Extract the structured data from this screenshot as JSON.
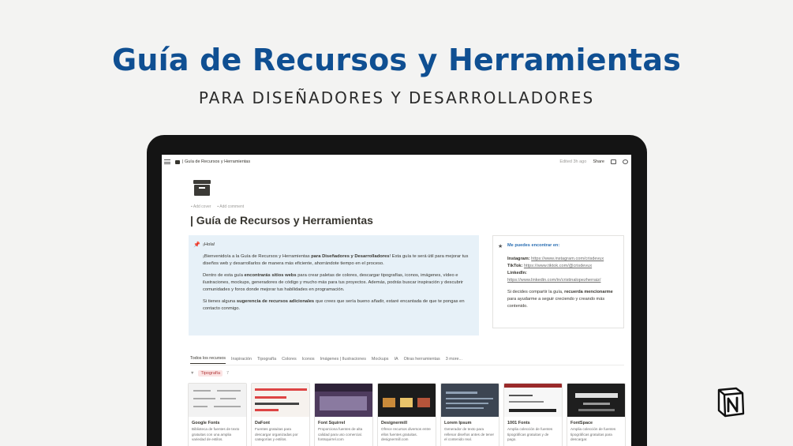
{
  "hero": {
    "title": "Guía de Recursos y Herramientas",
    "subtitle": "PARA DISEÑADORES Y DESARROLLADORES"
  },
  "topbar": {
    "breadcrumb": "| Guía de Recursos y Herramientas",
    "edited": "Edited 3h ago",
    "share": "Share"
  },
  "page": {
    "add_cover": "Add cover",
    "add_comment": "Add comment",
    "title": "| Guía de Recursos y Herramientas"
  },
  "callout": {
    "greeting": "¡Hola!",
    "p1_a": "¡Bienvenido/a a la Guía de Recursos y Herramientas ",
    "p1_b": "para Diseñadores y Desarrolladores",
    "p1_c": "! Esta guía te será útil para mejorar tus diseños web y desarrollarlos de manera más eficiente, ahorrándote tiempo en el proceso.",
    "p2_a": "Dentro de esta guía ",
    "p2_b": "encontrarás sitios webs",
    "p2_c": " para crear paletas de colores, descargar tipografías, iconos, imágenes, vídeo e ilustraciones, mockups, generadores de código y mucho más para tus proyectos. Además, podrás buscar inspiración y descubrir comunidades y foros donde mejorar tus habilidades en programación.",
    "p3_a": "Si tienes alguna ",
    "p3_b": "sugerencia de recursos adicionales",
    "p3_c": " que crees que sería bueno añadir, estaré encantada de que te pongas en contacto conmigo."
  },
  "side": {
    "heading": "Me puedes encontrar en:",
    "instagram_label": "Instagram:",
    "instagram_url": "https://www.instagram.com/crisdevux",
    "tiktok_label": "TikTok:",
    "tiktok_url": "https://www.tiktok.com/@crisdevux",
    "linkedin_label": "LinkedIn:",
    "linkedin_url": "https://www.linkedin.com/in/cristinalopezherraiz/",
    "share_a": "Si decides compartir la guía, ",
    "share_b": "recuerda mencionarme",
    "share_c": " para ayudarme a seguir creciendo y creando más contenido."
  },
  "tabs": [
    "Todos los recursos",
    "Inspiración",
    "Tipografía",
    "Colores",
    "Iconos",
    "Imágenes | Ilustraciones",
    "Mockups",
    "IA",
    "Otras herramientas",
    "3 more..."
  ],
  "group": {
    "label": "Tipografía",
    "count": "7"
  },
  "cards": [
    {
      "name": "Google Fonts",
      "desc": "Biblioteca de fuentes de texto gratuitas con una amplia variedad de estilos."
    },
    {
      "name": "DaFont",
      "desc": "Fuentes gratuitas para descargar organizadas por categorías y estilos."
    },
    {
      "name": "Font Squirrel",
      "desc": "Proporciona fuentes de alta calidad para uso comercial. fontsquirrel.com"
    },
    {
      "name": "Designermill",
      "desc": "Ofrece recursos diversos entre ellos fuentes gratuitas. designermill.com"
    },
    {
      "name": "Lorem Ipsum",
      "desc": "Generador de texto para rellenar diseños antes de tener el contenido real."
    },
    {
      "name": "1001 Fonts",
      "desc": "Amplia colección de fuentes tipográficas gratuitas y de pago."
    },
    {
      "name": "FontSpace",
      "desc": "Amplia colección de fuentes tipográficas gratuitas para descargar."
    }
  ],
  "colors": {
    "hero_title": "#0f4f92",
    "link_blue": "#2b6fb3",
    "callout_bg": "#e7f1f8"
  }
}
